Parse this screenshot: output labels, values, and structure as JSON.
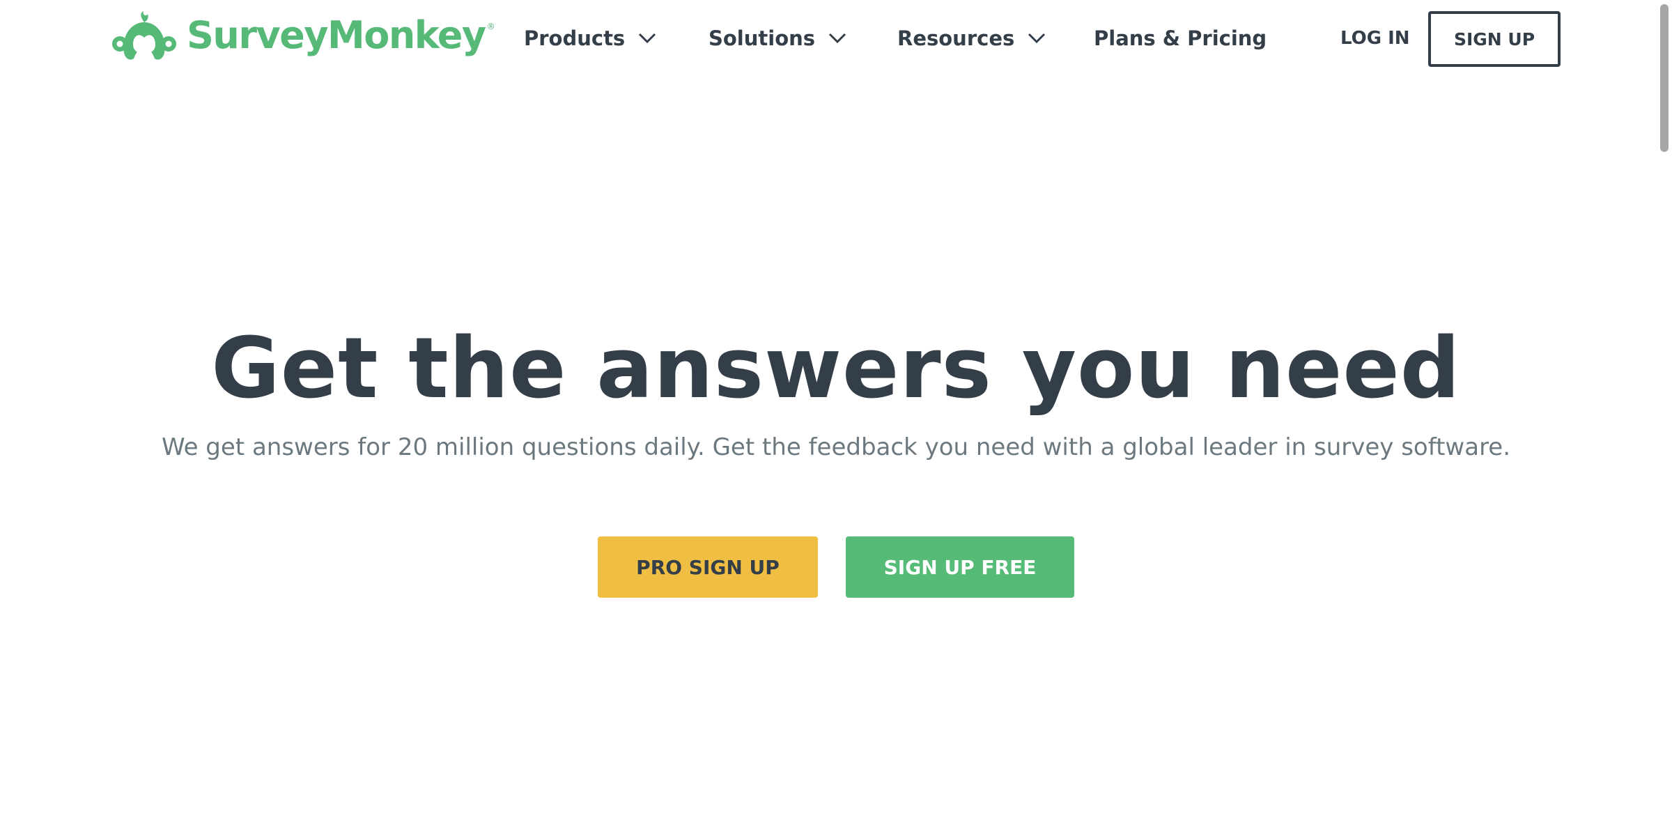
{
  "brand": {
    "name": "SurveyMonkey",
    "registered_mark": "®",
    "color": "#56b977"
  },
  "nav": {
    "items": [
      {
        "label": "Products",
        "has_dropdown": true,
        "icon": "chevron-down-icon"
      },
      {
        "label": "Solutions",
        "has_dropdown": true,
        "icon": "chevron-down-icon"
      },
      {
        "label": "Resources",
        "has_dropdown": true,
        "icon": "chevron-down-icon"
      },
      {
        "label": "Plans & Pricing",
        "has_dropdown": false
      }
    ],
    "login_label": "LOG IN",
    "signup_label": "SIGN UP"
  },
  "hero": {
    "title": "Get the answers you need",
    "subtitle": "We get answers for 20 million questions daily. Get the feedback you need with a global leader in survey software.",
    "pro_signup_label": "PRO SIGN UP",
    "free_signup_label": "SIGN UP FREE"
  },
  "colors": {
    "text_dark": "#333e48",
    "text_muted": "#6b787f",
    "pro_button": "#efbe43",
    "free_button": "#56bb77"
  }
}
